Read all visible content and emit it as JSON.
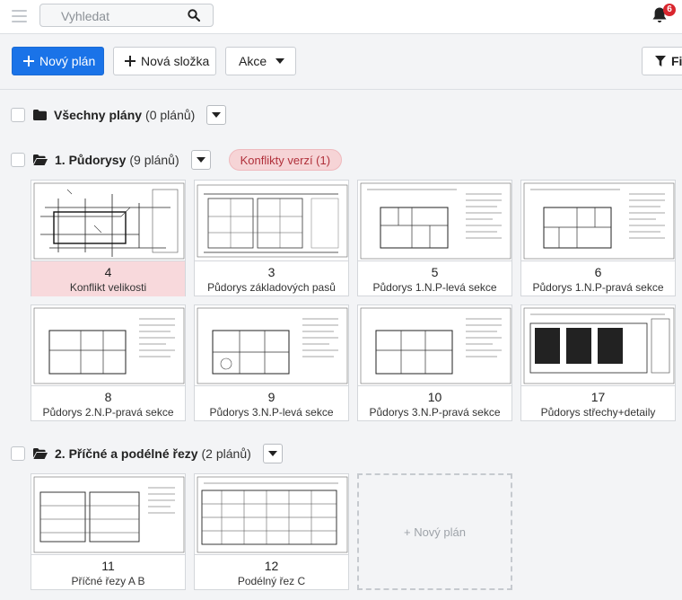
{
  "search": {
    "placeholder": "Vyhledat",
    "icon": "search-icon"
  },
  "notifications": {
    "count": "6",
    "icon": "bell-icon"
  },
  "toolbar": {
    "new_plan_label": "Nový plán",
    "new_folder_label": "Nová složka",
    "actions_label": "Akce",
    "filter_label": "Fi"
  },
  "all_plans": {
    "name": "Všechny plány",
    "count": "(0 plánů)"
  },
  "folders": [
    {
      "name": "1. Půdorysy",
      "count": "(9 plánů)",
      "conflict_label": "Konflikty verzí (1)",
      "plans": [
        {
          "number": "4",
          "name": "Konflikt velikosti",
          "warning": true
        },
        {
          "number": "3",
          "name": "Půdorys základových pasů",
          "warning": false
        },
        {
          "number": "5",
          "name": "Půdorys 1.N.P-levá sekce",
          "warning": false
        },
        {
          "number": "6",
          "name": "Půdorys 1.N.P-pravá sekce",
          "warning": false
        },
        {
          "number": "8",
          "name": "Půdorys 2.N.P-pravá sekce",
          "warning": false
        },
        {
          "number": "9",
          "name": "Půdorys 3.N.P-levá sekce",
          "warning": false
        },
        {
          "number": "10",
          "name": "Půdorys 3.N.P-pravá sekce",
          "warning": false
        },
        {
          "number": "17",
          "name": "Půdorys střechy+detaily",
          "warning": false
        }
      ]
    },
    {
      "name": "2. Příčné a podélné řezy",
      "count": "(2 plánů)",
      "plans": [
        {
          "number": "11",
          "name": "Příčné řezy A B",
          "warning": false
        },
        {
          "number": "12",
          "name": "Podélný řez C",
          "warning": false
        }
      ],
      "new_plan_label": "+ Nový plán"
    }
  ],
  "colors": {
    "primary": "#1a73e8",
    "danger": "#d9262e",
    "warning_bg": "#f8d9dc"
  }
}
